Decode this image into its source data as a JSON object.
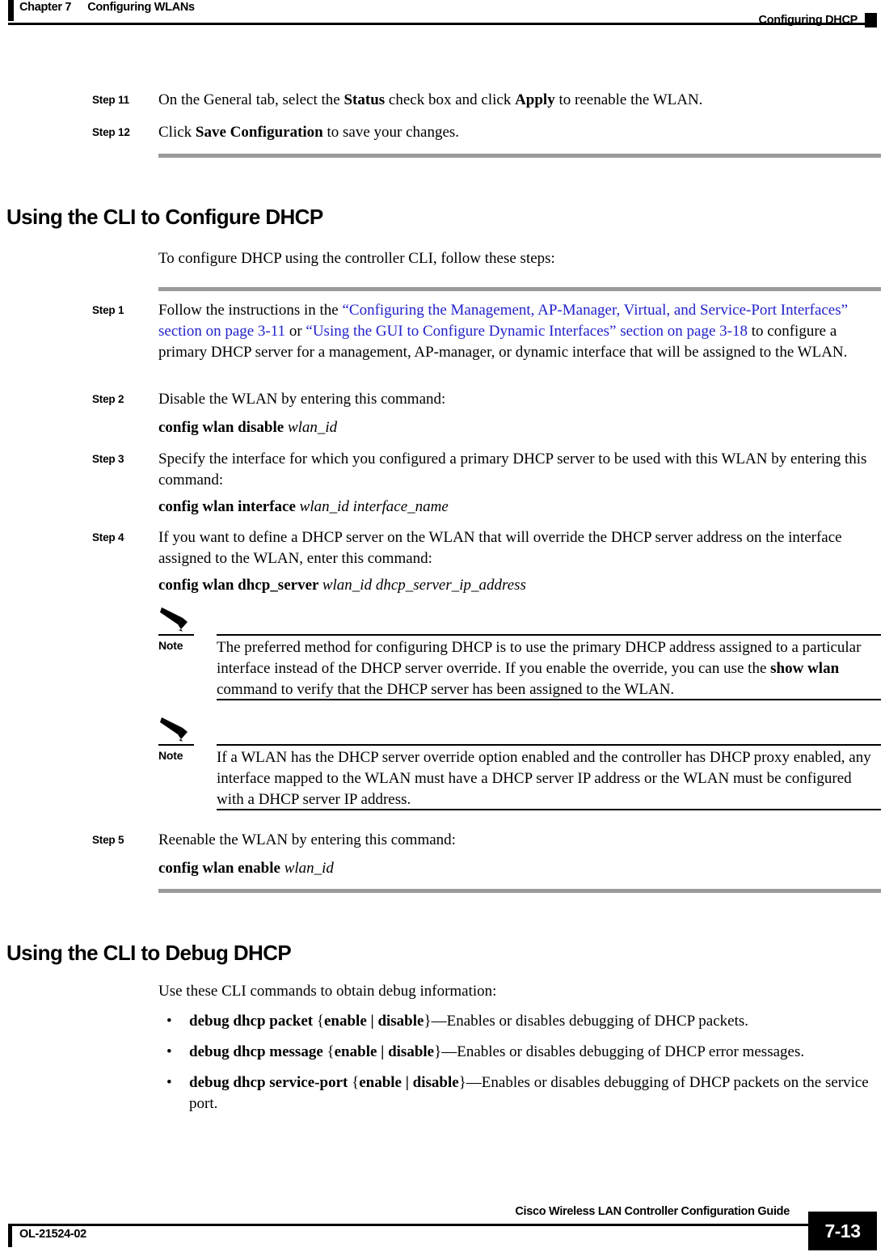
{
  "header": {
    "chapter_number": "Chapter 7",
    "chapter_title": "Configuring WLANs",
    "running_head_right": "Configuring DHCP"
  },
  "top_steps": [
    {
      "label": "Step 11",
      "parts": [
        {
          "text": "On the General tab, select the ",
          "style": "normal"
        },
        {
          "text": "Status",
          "style": "bold"
        },
        {
          "text": " check box and click ",
          "style": "normal"
        },
        {
          "text": "Apply",
          "style": "bold"
        },
        {
          "text": " to reenable the WLAN.",
          "style": "normal"
        }
      ]
    },
    {
      "label": "Step 12",
      "parts": [
        {
          "text": "Click ",
          "style": "normal"
        },
        {
          "text": "Save Configuration",
          "style": "bold"
        },
        {
          "text": " to save your changes.",
          "style": "normal"
        }
      ]
    }
  ],
  "section_configure": {
    "heading": "Using the CLI to Configure DHCP",
    "intro": "To configure DHCP using the controller CLI, follow these steps:",
    "steps": [
      {
        "label": "Step 1",
        "parts": [
          {
            "text": "Follow the instructions in the ",
            "style": "normal"
          },
          {
            "text": "“Configuring the Management, AP-Manager, Virtual, and Service-Port Interfaces” section on page 3-11",
            "style": "link"
          },
          {
            "text": " or ",
            "style": "normal"
          },
          {
            "text": "“Using the GUI to Configure Dynamic Interfaces” section on page 3-18",
            "style": "link"
          },
          {
            "text": " to configure a primary DHCP server for a management, AP-manager, or dynamic interface that will be assigned to the WLAN.",
            "style": "normal"
          }
        ]
      },
      {
        "label": "Step 2",
        "parts": [
          {
            "text": "Disable the WLAN by entering this command:",
            "style": "normal"
          }
        ],
        "command": [
          {
            "text": "config wlan disable ",
            "style": "bold"
          },
          {
            "text": "wlan_id",
            "style": "italic"
          }
        ]
      },
      {
        "label": "Step 3",
        "parts": [
          {
            "text": "Specify the interface for which you configured a primary DHCP server to be used with this WLAN by entering this command:",
            "style": "normal"
          }
        ],
        "command": [
          {
            "text": "config wlan interface ",
            "style": "bold"
          },
          {
            "text": "wlan_id interface_name",
            "style": "italic"
          }
        ]
      },
      {
        "label": "Step 4",
        "parts": [
          {
            "text": "If you want to define a DHCP server on the WLAN that will override the DHCP server address on the interface assigned to the WLAN, enter this command:",
            "style": "normal"
          }
        ],
        "command": [
          {
            "text": "config wlan dhcp_server ",
            "style": "bold"
          },
          {
            "text": "wlan_id dhcp_server_ip_address",
            "style": "italic"
          }
        ]
      },
      {
        "label": "Step 5",
        "parts": [
          {
            "text": "Reenable the WLAN by entering this command:",
            "style": "normal"
          }
        ],
        "command": [
          {
            "text": "config wlan enable ",
            "style": "bold"
          },
          {
            "text": "wlan_id",
            "style": "italic"
          }
        ]
      }
    ],
    "notes": [
      {
        "label": "Note",
        "icon": "note-pencil-icon",
        "parts": [
          {
            "text": "The preferred method for configuring DHCP is to use the primary DHCP address assigned to a particular interface instead of the DHCP server override. If you enable the override, you can use the ",
            "style": "normal"
          },
          {
            "text": "show wlan",
            "style": "bold"
          },
          {
            "text": " command to verify that the DHCP server has been assigned to the WLAN.",
            "style": "normal"
          }
        ]
      },
      {
        "label": "Note",
        "icon": "note-pencil-icon",
        "parts": [
          {
            "text": "If a WLAN has the DHCP server override option enabled and the controller has DHCP proxy enabled, any interface mapped to the WLAN must have a DHCP server IP address or the WLAN must be configured with a DHCP server IP address.",
            "style": "normal"
          }
        ]
      }
    ]
  },
  "section_debug": {
    "heading": "Using the CLI to Debug DHCP",
    "intro": "Use these CLI commands to obtain debug information:",
    "bullets": [
      {
        "parts": [
          {
            "text": "debug dhcp packet ",
            "style": "bold"
          },
          {
            "text": "{",
            "style": "normal"
          },
          {
            "text": "enable | disable",
            "style": "bold"
          },
          {
            "text": "}—Enables or disables debugging of DHCP packets.",
            "style": "normal"
          }
        ]
      },
      {
        "parts": [
          {
            "text": "debug dhcp message ",
            "style": "bold"
          },
          {
            "text": "{",
            "style": "normal"
          },
          {
            "text": "enable | disable",
            "style": "bold"
          },
          {
            "text": "}—Enables or disables debugging of DHCP error messages.",
            "style": "normal"
          }
        ]
      },
      {
        "parts": [
          {
            "text": "debug dhcp service-port ",
            "style": "bold"
          },
          {
            "text": "{",
            "style": "normal"
          },
          {
            "text": "enable | disable",
            "style": "bold"
          },
          {
            "text": "}—Enables or disables debugging of DHCP packets on the service port.",
            "style": "normal"
          }
        ]
      }
    ]
  },
  "footer": {
    "guide_title": "Cisco Wireless LAN Controller Configuration Guide",
    "doc_id": "OL-21524-02",
    "page_number": "7-13"
  },
  "colors": {
    "link": "#2222cc",
    "rule_gray": "#9a9a9a",
    "ink": "#000000"
  }
}
